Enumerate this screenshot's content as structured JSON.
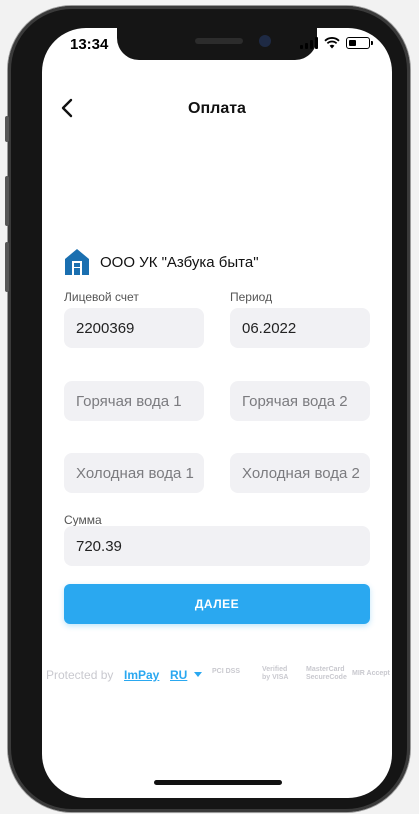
{
  "status": {
    "time": "13:34",
    "battery_level": 0.4
  },
  "header": {
    "title": "Оплата"
  },
  "company": {
    "name": "ООО УК \"Азбука быта\""
  },
  "form": {
    "account": {
      "label": "Лицевой счет",
      "value": "2200369"
    },
    "period": {
      "label": "Период",
      "value": "06.2022"
    },
    "hot_water_1": {
      "placeholder": "Горячая вода 1"
    },
    "hot_water_2": {
      "placeholder": "Горячая вода 2"
    },
    "cold_water_1": {
      "placeholder": "Холодная вода 1"
    },
    "cold_water_2": {
      "placeholder": "Холодная вода 2"
    },
    "sum": {
      "label": "Сумма",
      "value": "720.39"
    },
    "next_button": "ДАЛЕЕ"
  },
  "footer": {
    "protected_by": "Protected by",
    "brand": "ImPay",
    "language": "RU",
    "badges": [
      "PCI DSS",
      "Verified by VISA",
      "MasterCard SecureCode",
      "MIR Accept"
    ]
  },
  "colors": {
    "accent": "#2aa8f0",
    "house_icon": "#1a6fb0",
    "field_bg": "#f1f1f4"
  },
  "icons": [
    "back-chevron-icon",
    "house-icon",
    "signal-icon",
    "wifi-icon",
    "battery-icon",
    "caret-down-icon"
  ]
}
